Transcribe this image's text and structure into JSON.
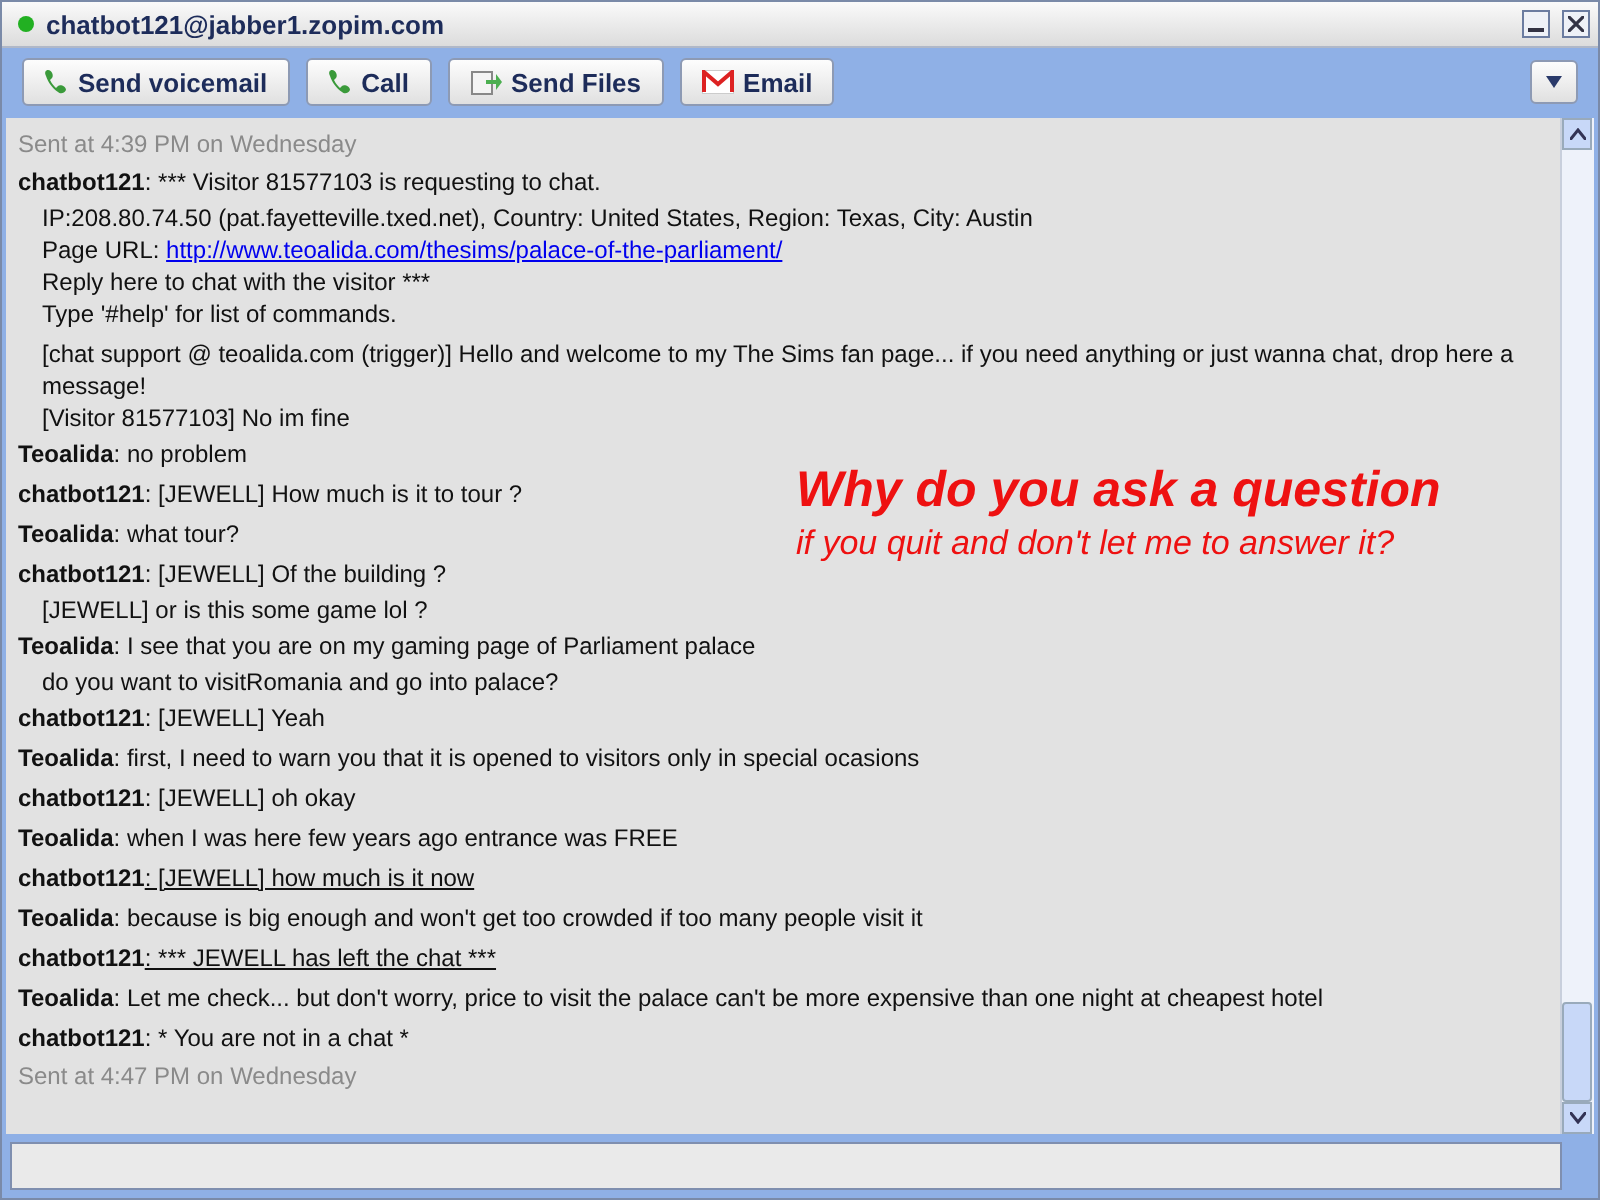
{
  "window": {
    "title": "chatbot121@jabber1.zopim.com",
    "online": true
  },
  "toolbar": [
    {
      "label": "Send voicemail",
      "kind": "phone"
    },
    {
      "label": "Call",
      "kind": "phone"
    },
    {
      "label": "Send Files",
      "kind": "files"
    },
    {
      "label": "Email",
      "kind": "mail"
    }
  ],
  "messages": [
    {
      "kind": "time",
      "text": "Sent at 4:39 PM on Wednesday"
    },
    {
      "kind": "msg",
      "sender": "chatbot121",
      "text": ": *** Visitor 81577103 is requesting to chat.",
      "underlined": false,
      "more": [
        {
          "text": "IP:208.80.74.50 (pat.fayetteville.txed.net), Country: United States, Region: Texas, City: Austin"
        },
        {
          "text": "Page URL:",
          "link": "http://www.teoalida.com/thesims/palace-of-the-parliament/"
        },
        {
          "text": "Reply here to chat with the visitor ***"
        },
        {
          "text": "Type '#help' for list of commands."
        },
        {
          "text": "[chat support @ teoalida.com (trigger)] Hello and welcome to my The Sims fan page... if you need anything or just wanna chat, drop here a message!",
          "spaced": true
        },
        {
          "text": "[Visitor 81577103] No im fine"
        }
      ]
    },
    {
      "kind": "msg",
      "sender": "Teoalida",
      "text": ": no problem",
      "underlined": false
    },
    {
      "kind": "msg",
      "sender": "chatbot121",
      "text": ": [JEWELL] How much is it to tour ?",
      "underlined": false
    },
    {
      "kind": "msg",
      "sender": "Teoalida",
      "text": ": what tour?",
      "underlined": false
    },
    {
      "kind": "msg",
      "sender": "chatbot121",
      "text": ": [JEWELL] Of the building ?",
      "underlined": false,
      "more": [
        {
          "text": "[JEWELL] or is this some game lol ?"
        }
      ]
    },
    {
      "kind": "msg",
      "sender": "Teoalida",
      "text": ": I see that you are on my gaming page of Parliament palace",
      "underlined": false,
      "more": [
        {
          "text": "do you want to visitRomania and go into palace?"
        }
      ]
    },
    {
      "kind": "msg",
      "sender": "chatbot121",
      "text": ": [JEWELL] Yeah",
      "underlined": false
    },
    {
      "kind": "msg",
      "sender": "Teoalida",
      "text": ": first, I need to warn you that it is opened to visitors only in special ocasions",
      "underlined": false
    },
    {
      "kind": "msg",
      "sender": "chatbot121",
      "text": ": [JEWELL] oh okay",
      "underlined": false
    },
    {
      "kind": "msg",
      "sender": "Teoalida",
      "text": ": when I was here few years ago entrance was FREE",
      "underlined": false
    },
    {
      "kind": "msg",
      "sender": "chatbot121",
      "text": ": [JEWELL] how much is it now",
      "underlined": true
    },
    {
      "kind": "msg",
      "sender": "Teoalida",
      "text": ": because is big enough and won't get too crowded if too many people visit it",
      "underlined": false
    },
    {
      "kind": "msg",
      "sender": "chatbot121",
      "text": ": *** JEWELL has left the chat ***",
      "underlined": true
    },
    {
      "kind": "msg",
      "sender": "Teoalida",
      "text": ": Let me check... but don't worry, price to visit the palace can't be more expensive than one night at cheapest hotel",
      "underlined": false
    },
    {
      "kind": "msg",
      "sender": "chatbot121",
      "text": ": * You are not in a chat *",
      "underlined": false
    },
    {
      "kind": "time",
      "text": "Sent at 4:47 PM on Wednesday"
    }
  ],
  "annotation": {
    "headline": "Why do you ask a question",
    "subline": "if you quit and don't let me to answer it?"
  }
}
